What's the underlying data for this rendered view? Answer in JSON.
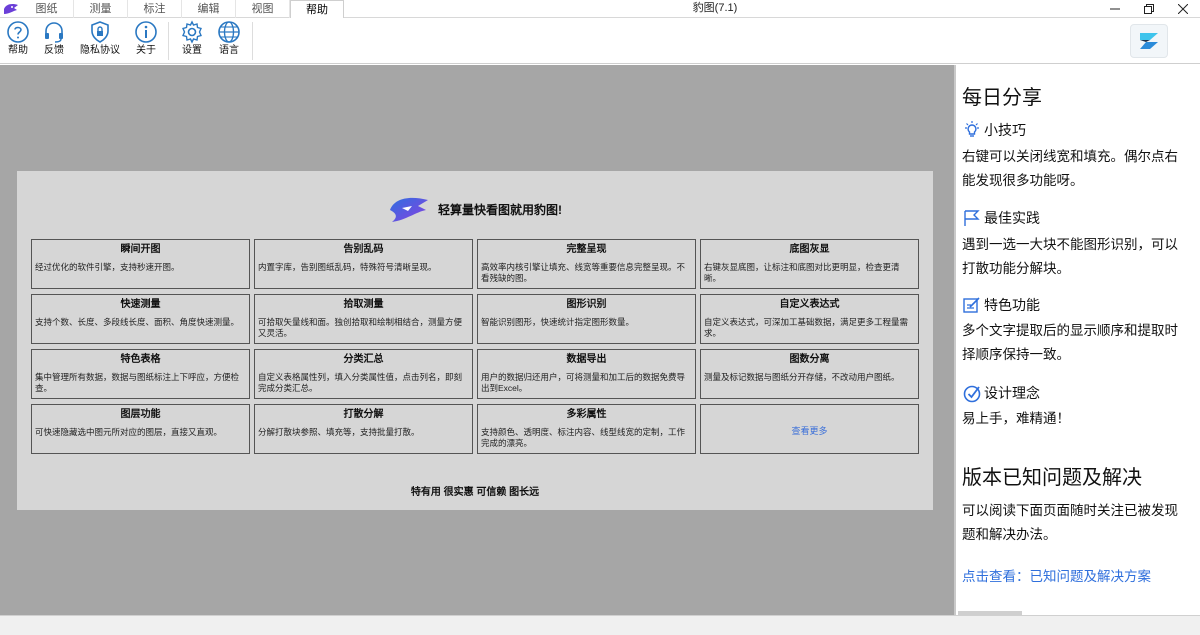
{
  "window": {
    "title": "豹图(7.1)",
    "tabs": [
      {
        "label": "图纸",
        "active": false
      },
      {
        "label": "测量",
        "active": false
      },
      {
        "label": "标注",
        "active": false
      },
      {
        "label": "编辑",
        "active": false
      },
      {
        "label": "视图",
        "active": false
      },
      {
        "label": "帮助",
        "active": true
      }
    ]
  },
  "ribbon": {
    "buttons": [
      {
        "label": "帮助",
        "icon": "question-circle-icon"
      },
      {
        "label": "反馈",
        "icon": "headset-icon"
      },
      {
        "label": "隐私协议",
        "icon": "shield-icon"
      },
      {
        "label": "关于",
        "icon": "info-icon"
      },
      {
        "label": "设置",
        "icon": "gear-icon"
      },
      {
        "label": "语言",
        "icon": "globe-icon"
      }
    ]
  },
  "welcome": {
    "banner": "轻算量快看图就用豹图!",
    "features": [
      {
        "title": "瞬间开图",
        "desc": "经过优化的软件引擎，支持秒速开图。"
      },
      {
        "title": "告别乱码",
        "desc": "内置字库，告别图纸乱码，特殊符号清晰呈现。"
      },
      {
        "title": "完整呈现",
        "desc": "高效率内核引擎让填充、线宽等重要信息完整呈现。不看残缺的图。"
      },
      {
        "title": "底图灰显",
        "desc": "右键灰显底图，让标注和底图对比更明显，检查更清晰。"
      },
      {
        "title": "快速测量",
        "desc": "支持个数、长度、多段线长度、面积、角度快速测量。"
      },
      {
        "title": "拾取测量",
        "desc": "可拾取矢量线和面。独创拾取和绘制相结合，测量方便又灵活。"
      },
      {
        "title": "图形识别",
        "desc": "智能识别图形，快速统计指定图形数量。"
      },
      {
        "title": "自定义表达式",
        "desc": "自定义表达式，可深加工基础数据，满足更多工程量需求。"
      },
      {
        "title": "特色表格",
        "desc": "集中管理所有数据，数据与图纸标注上下呼应，方便检查。"
      },
      {
        "title": "分类汇总",
        "desc": "自定义表格属性列，填入分类属性值，点击列名，即刻完成分类汇总。"
      },
      {
        "title": "数据导出",
        "desc": "用户的数据归还用户，可将测量和加工后的数据免费导出到Excel。"
      },
      {
        "title": "图数分离",
        "desc": "测量及标记数据与图纸分开存储，不改动用户图纸。"
      },
      {
        "title": "图层功能",
        "desc": "可快速隐藏选中图元所对应的图层，直接又直观。"
      },
      {
        "title": "打散分解",
        "desc": "分解打散块参照、填充等，支持批量打散。"
      },
      {
        "title": "多彩属性",
        "desc": "支持颜色、透明度、标注内容、线型线宽的定制，工作完成的漂亮。"
      }
    ],
    "more_link": "查看更多",
    "slogan": "特有用 很实惠 可信赖 图长远"
  },
  "panel": {
    "daily_title": "每日分享",
    "tips": [
      {
        "icon": "bulb-icon",
        "heading": "小技巧",
        "lines": [
          "右键可以关闭线宽和填充。偶尔点右",
          "能发现很多功能呀。"
        ]
      },
      {
        "icon": "flag-icon",
        "heading": "最佳实践",
        "lines": [
          "遇到一选一大块不能图形识别，可以",
          "打散功能分解块。"
        ]
      },
      {
        "icon": "edit-icon",
        "heading": "特色功能",
        "lines": [
          "多个文字提取后的显示顺序和提取时",
          "择顺序保持一致。"
        ]
      },
      {
        "icon": "target-icon",
        "heading": "设计理念",
        "lines": [
          "易上手，难精通！"
        ]
      }
    ],
    "issues_title": "版本已知问题及解决",
    "issues_lines": [
      "可以阅读下面页面随时关注已被发现",
      "题和解决办法。"
    ],
    "issues_link": "点击查看：已知问题及解决方案"
  },
  "colors": {
    "main_bg": "#a6a6a6",
    "card_bg": "#d6d6d6",
    "link": "#2f6fdc",
    "accent": "#7b3fe4"
  }
}
